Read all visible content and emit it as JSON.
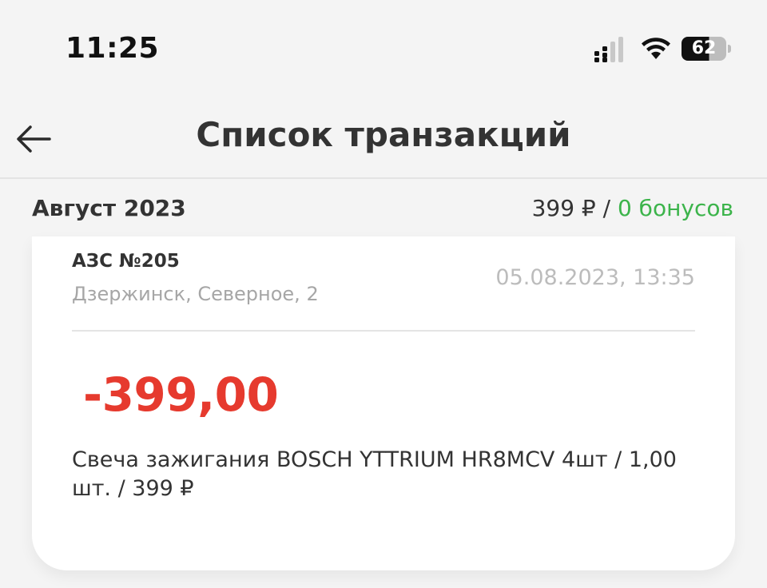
{
  "status_bar": {
    "time": "11:25",
    "battery_level": "62",
    "battery_fraction": 0.62,
    "icons": [
      "signal-icon",
      "wifi-icon",
      "battery-icon"
    ]
  },
  "nav": {
    "back_icon": "arrow-left-icon",
    "title": "Список транзакций"
  },
  "month": {
    "label": "Август 2023",
    "total": "399 ₽ / ",
    "bonus": "0 бонусов"
  },
  "transaction": {
    "station": "АЗС №205",
    "address": "Дзержинск, Северное, 2",
    "datetime": "05.08.2023, 13:35",
    "amount": "-399,00",
    "description": "Свеча зажигания BOSCH YTTRIUM HR8MCV 4шт / 1,00 шт. / 399 ₽"
  },
  "colors": {
    "background": "#f4f4f4",
    "card": "#ffffff",
    "amount_negative": "#e63a2e",
    "bonus": "#3cb44b",
    "muted_text": "#a6a6a6"
  }
}
